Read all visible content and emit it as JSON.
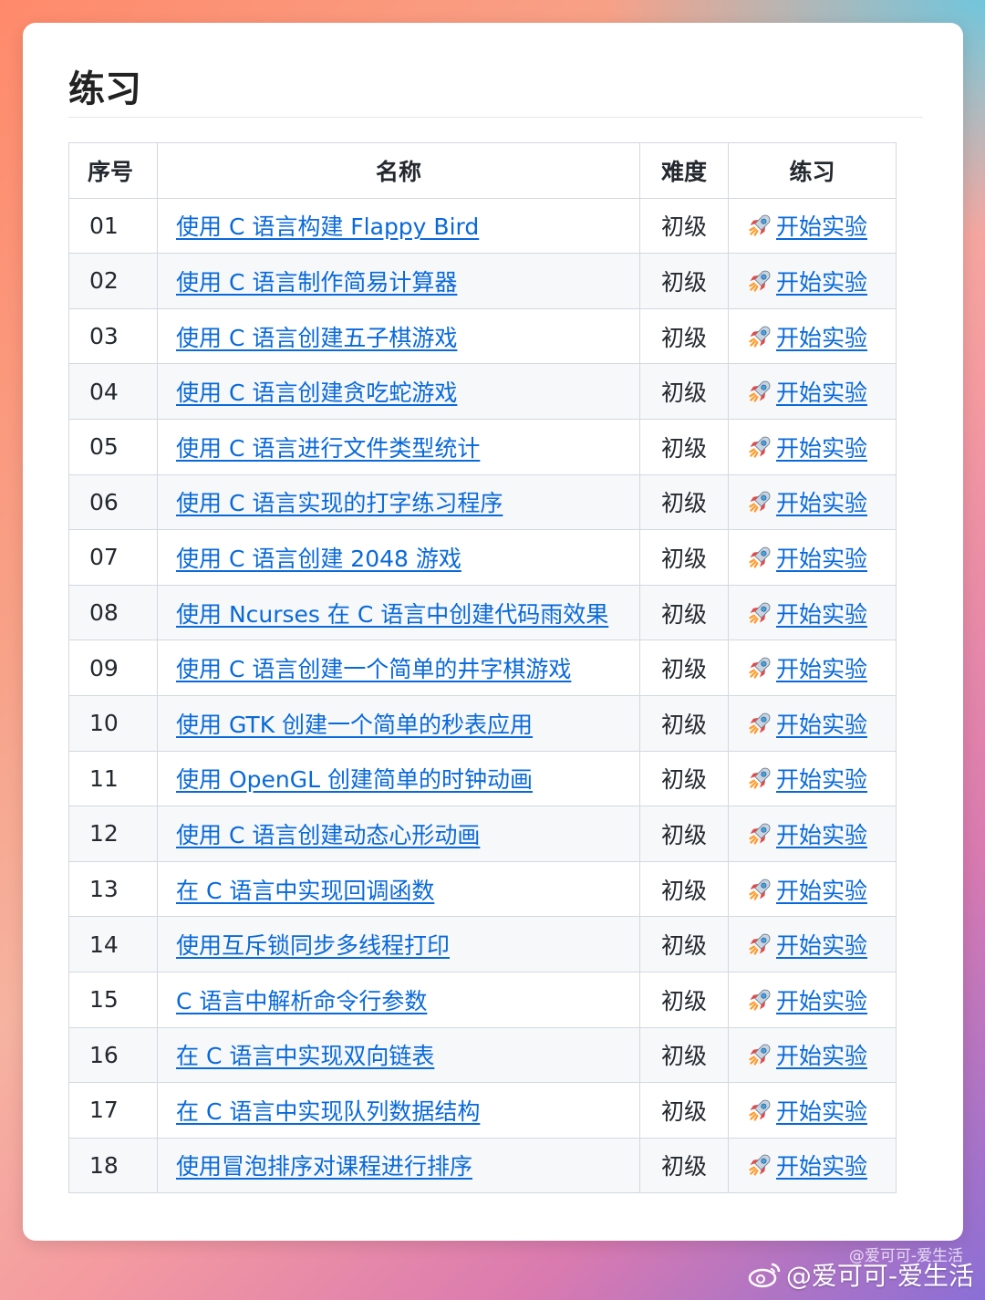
{
  "section_title": "练习",
  "table": {
    "headers": {
      "num": "序号",
      "name": "名称",
      "level": "难度",
      "practice": "练习"
    },
    "rows": [
      {
        "num": "01",
        "name": "使用 C 语言构建 Flappy Bird",
        "level": "初级",
        "action": "开始实验"
      },
      {
        "num": "02",
        "name": "使用 C 语言制作简易计算器",
        "level": "初级",
        "action": "开始实验"
      },
      {
        "num": "03",
        "name": "使用 C 语言创建五子棋游戏",
        "level": "初级",
        "action": "开始实验"
      },
      {
        "num": "04",
        "name": "使用 C 语言创建贪吃蛇游戏",
        "level": "初级",
        "action": "开始实验"
      },
      {
        "num": "05",
        "name": "使用 C 语言进行文件类型统计",
        "level": "初级",
        "action": "开始实验"
      },
      {
        "num": "06",
        "name": "使用 C 语言实现的打字练习程序",
        "level": "初级",
        "action": "开始实验"
      },
      {
        "num": "07",
        "name": "使用 C 语言创建 2048 游戏",
        "level": "初级",
        "action": "开始实验"
      },
      {
        "num": "08",
        "name": "使用 Ncurses 在 C 语言中创建代码雨效果",
        "level": "初级",
        "action": "开始实验"
      },
      {
        "num": "09",
        "name": "使用 C 语言创建一个简单的井字棋游戏",
        "level": "初级",
        "action": "开始实验"
      },
      {
        "num": "10",
        "name": "使用 GTK 创建一个简单的秒表应用",
        "level": "初级",
        "action": "开始实验"
      },
      {
        "num": "11",
        "name": "使用 OpenGL 创建简单的时钟动画",
        "level": "初级",
        "action": "开始实验"
      },
      {
        "num": "12",
        "name": "使用 C 语言创建动态心形动画",
        "level": "初级",
        "action": "开始实验"
      },
      {
        "num": "13",
        "name": "在 C 语言中实现回调函数",
        "level": "初级",
        "action": "开始实验"
      },
      {
        "num": "14",
        "name": "使用互斥锁同步多线程打印",
        "level": "初级",
        "action": "开始实验"
      },
      {
        "num": "15",
        "name": "C 语言中解析命令行参数",
        "level": "初级",
        "action": "开始实验"
      },
      {
        "num": "16",
        "name": "在 C 语言中实现双向链表",
        "level": "初级",
        "action": "开始实验"
      },
      {
        "num": "17",
        "name": "在 C 语言中实现队列数据结构",
        "level": "初级",
        "action": "开始实验"
      },
      {
        "num": "18",
        "name": "使用冒泡排序对课程进行排序",
        "level": "初级",
        "action": "开始实验"
      }
    ]
  },
  "icons": {
    "action_icon": "rocket-icon",
    "watermark_icon": "weibo-icon"
  },
  "colors": {
    "link": "#0969da",
    "alt_row": "#f6f8fa",
    "border": "#d3d9e0"
  },
  "watermark": {
    "main": "@爱可可-爱生活",
    "faint": "@爱可可-爱生活"
  }
}
